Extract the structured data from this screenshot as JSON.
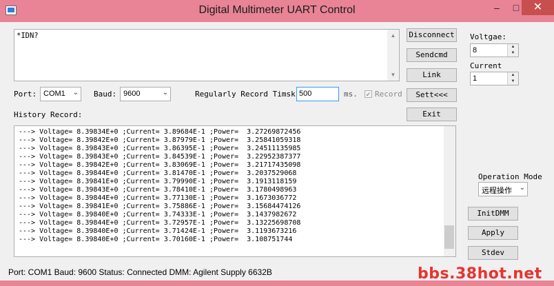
{
  "window": {
    "title": "Digital Multimeter UART Control",
    "min_glyph": "–",
    "max_glyph": "□",
    "close_glyph": "✕"
  },
  "command": {
    "text": "*IDN?"
  },
  "buttons": {
    "disconnect": "Disconnect",
    "sendcmd": "Sendcmd",
    "link": "Link",
    "sett": "Sett<<<",
    "exit": "Exit",
    "initdmm": "InitDMM",
    "apply": "Apply",
    "stdev": "Stdev"
  },
  "port": {
    "label": "Port:",
    "value": "COM1"
  },
  "baud": {
    "label": "Baud:",
    "value": "9600"
  },
  "record": {
    "label": "Regularly Record Timsk:",
    "value": "500",
    "unit": "ms.",
    "checkbox_label": "Record",
    "checked": true
  },
  "history": {
    "label": "History Record:",
    "lines": [
      "---> Voltage= 8.39834E+0 ;Current= 3.89684E-1 ;Power=  3.27269872456",
      "---> Voltage= 8.39842E+0 ;Current= 3.87979E-1 ;Power=  3.25841059318",
      "---> Voltage= 8.39843E+0 ;Current= 3.86395E-1 ;Power=  3.24511135985",
      "---> Voltage= 8.39843E+0 ;Current= 3.84539E-1 ;Power=  3.22952387377",
      "---> Voltage= 8.39842E+0 ;Current= 3.83069E-1 ;Power=  3.21717435098",
      "---> Voltage= 8.39844E+0 ;Current= 3.81470E-1 ;Power=  3.2037529068",
      "---> Voltage= 8.39841E+0 ;Current= 3.79990E-1 ;Power=  3.1913118159",
      "---> Voltage= 8.39843E+0 ;Current= 3.78410E-1 ;Power=  3.1780498963",
      "---> Voltage= 8.39844E+0 ;Current= 3.77130E-1 ;Power=  3.1673036772",
      "---> Voltage= 8.39841E+0 ;Current= 3.75886E-1 ;Power=  3.15684474126",
      "---> Voltage= 8.39840E+0 ;Current= 3.74333E-1 ;Power=  3.1437982672",
      "---> Voltage= 8.39844E+0 ;Current= 3.72957E-1 ;Power=  3.13225698708",
      "---> Voltage= 8.39840E+0 ;Current= 3.71424E-1 ;Power=  3.1193673216",
      "---> Voltage= 8.39840E+0 ;Current= 3.70160E-1 ;Power=  3.108751744"
    ]
  },
  "voltage": {
    "label": "Voltgae:",
    "value": "8"
  },
  "current": {
    "label": "Current",
    "value": "1"
  },
  "operation_mode": {
    "label": "Operation Mode",
    "value": "远程操作"
  },
  "status_bar": {
    "text": "Port: COM1  Baud: 9600  Status: Connected  DMM: Agilent Supply 6632B"
  },
  "watermark": {
    "text": "bbs.38hot.net"
  },
  "colors": {
    "titlebar": "#e88495",
    "close": "#c7504f",
    "watermark": "#e8332f"
  }
}
